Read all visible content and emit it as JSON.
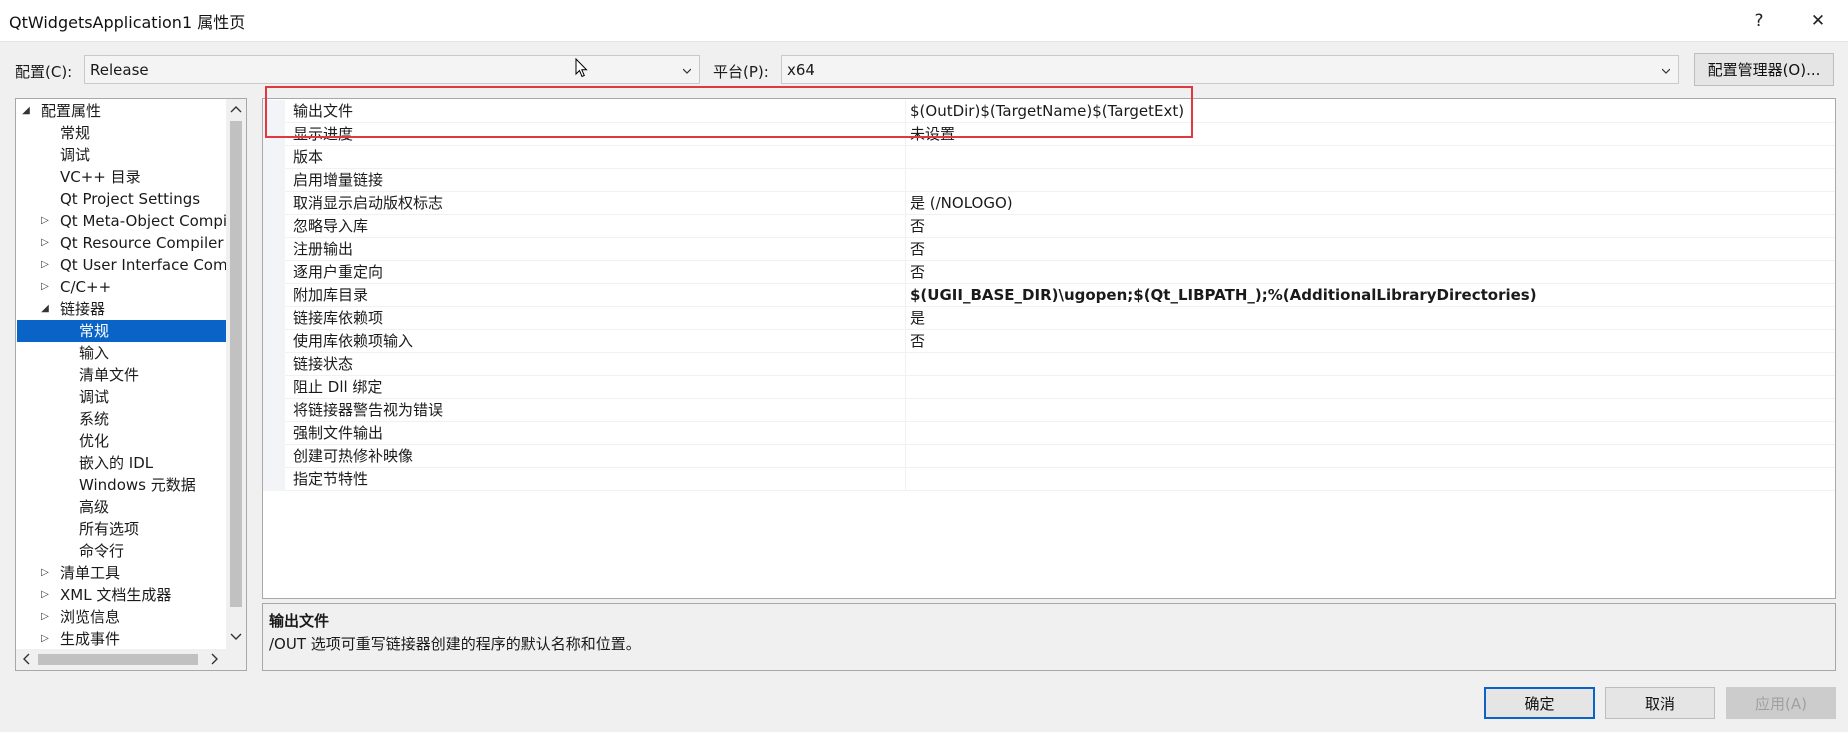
{
  "window": {
    "title": "QtWidgetsApplication1 属性页",
    "help_glyph": "?",
    "close_glyph": "✕"
  },
  "toolbar": {
    "config_label": "配置(C):",
    "config_value": "Release",
    "platform_label": "平台(P):",
    "platform_value": "x64",
    "config_manager_label": "配置管理器(O)..."
  },
  "tree": {
    "items": [
      {
        "label": "配置属性",
        "indent": 0,
        "expander": "◢",
        "selected": false
      },
      {
        "label": "常规",
        "indent": 1,
        "expander": "",
        "selected": false
      },
      {
        "label": "调试",
        "indent": 1,
        "expander": "",
        "selected": false
      },
      {
        "label": "VC++ 目录",
        "indent": 1,
        "expander": "",
        "selected": false
      },
      {
        "label": "Qt Project Settings",
        "indent": 1,
        "expander": "",
        "selected": false
      },
      {
        "label": "Qt Meta-Object Compi",
        "indent": 1,
        "expander": "▷",
        "selected": false
      },
      {
        "label": "Qt Resource Compiler",
        "indent": 1,
        "expander": "▷",
        "selected": false
      },
      {
        "label": "Qt User Interface Comp",
        "indent": 1,
        "expander": "▷",
        "selected": false
      },
      {
        "label": "C/C++",
        "indent": 1,
        "expander": "▷",
        "selected": false
      },
      {
        "label": "链接器",
        "indent": 1,
        "expander": "◢",
        "selected": false
      },
      {
        "label": "常规",
        "indent": 2,
        "expander": "",
        "selected": true
      },
      {
        "label": "输入",
        "indent": 2,
        "expander": "",
        "selected": false
      },
      {
        "label": "清单文件",
        "indent": 2,
        "expander": "",
        "selected": false
      },
      {
        "label": "调试",
        "indent": 2,
        "expander": "",
        "selected": false
      },
      {
        "label": "系统",
        "indent": 2,
        "expander": "",
        "selected": false
      },
      {
        "label": "优化",
        "indent": 2,
        "expander": "",
        "selected": false
      },
      {
        "label": "嵌入的 IDL",
        "indent": 2,
        "expander": "",
        "selected": false
      },
      {
        "label": "Windows 元数据",
        "indent": 2,
        "expander": "",
        "selected": false
      },
      {
        "label": "高级",
        "indent": 2,
        "expander": "",
        "selected": false
      },
      {
        "label": "所有选项",
        "indent": 2,
        "expander": "",
        "selected": false
      },
      {
        "label": "命令行",
        "indent": 2,
        "expander": "",
        "selected": false
      },
      {
        "label": "清单工具",
        "indent": 1,
        "expander": "▷",
        "selected": false
      },
      {
        "label": "XML 文档生成器",
        "indent": 1,
        "expander": "▷",
        "selected": false
      },
      {
        "label": "浏览信息",
        "indent": 1,
        "expander": "▷",
        "selected": false
      },
      {
        "label": "生成事件",
        "indent": 1,
        "expander": "▷",
        "selected": false
      }
    ]
  },
  "properties": [
    {
      "name": "输出文件",
      "value": "$(OutDir)$(TargetName)$(TargetExt)",
      "bold": false
    },
    {
      "name": "显示进度",
      "value": "未设置",
      "bold": false
    },
    {
      "name": "版本",
      "value": "",
      "bold": false
    },
    {
      "name": "启用增量链接",
      "value": "",
      "bold": false
    },
    {
      "name": "取消显示启动版权标志",
      "value": "是 (/NOLOGO)",
      "bold": false
    },
    {
      "name": "忽略导入库",
      "value": "否",
      "bold": false
    },
    {
      "name": "注册输出",
      "value": "否",
      "bold": false
    },
    {
      "name": "逐用户重定向",
      "value": "否",
      "bold": false
    },
    {
      "name": "附加库目录",
      "value": "$(UGII_BASE_DIR)\\ugopen;$(Qt_LIBPATH_);%(AdditionalLibraryDirectories)",
      "bold": true
    },
    {
      "name": "链接库依赖项",
      "value": "是",
      "bold": false
    },
    {
      "name": "使用库依赖项输入",
      "value": "否",
      "bold": false
    },
    {
      "name": "链接状态",
      "value": "",
      "bold": false
    },
    {
      "name": "阻止 Dll 绑定",
      "value": "",
      "bold": false
    },
    {
      "name": "将链接器警告视为错误",
      "value": "",
      "bold": false
    },
    {
      "name": "强制文件输出",
      "value": "",
      "bold": false
    },
    {
      "name": "创建可热修补映像",
      "value": "",
      "bold": false
    },
    {
      "name": "指定节特性",
      "value": "",
      "bold": false
    }
  ],
  "description": {
    "title": "输出文件",
    "text": "/OUT 选项可重写链接器创建的程序的默认名称和位置。"
  },
  "buttons": {
    "ok": "确定",
    "cancel": "取消",
    "apply": "应用(A)"
  },
  "colors": {
    "selection": "#0a64c8",
    "highlight_box": "#e3363e"
  }
}
